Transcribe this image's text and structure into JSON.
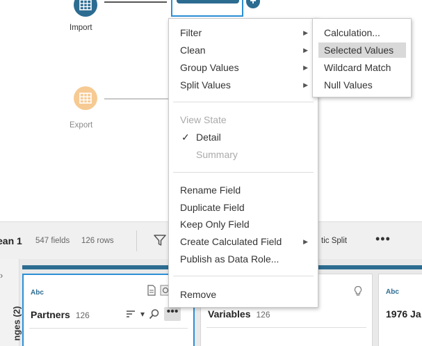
{
  "flow": {
    "import_label": "Import",
    "export_label": "Export",
    "plus_symbol": "+",
    "colors": {
      "import_node": "#2c6c91",
      "export_node": "#f6ca93",
      "selection": "#2b8fd6"
    }
  },
  "toolbar": {
    "step_name": "ean 1",
    "fields": "547 fields",
    "rows": "126 rows",
    "filter_icon": "filter-icon",
    "split_label": "tic Split",
    "more_label": "•••"
  },
  "profile": {
    "side_chevron": "›",
    "side_label": "nges (2)",
    "cards": [
      {
        "type": "Abc",
        "name": "Partners",
        "count": "126"
      },
      {
        "type": "",
        "name": "Variables",
        "count": "126"
      },
      {
        "type": "Abc",
        "name": "1976 Ja",
        "count": ""
      }
    ],
    "more_label": "•••",
    "dropdown_glyph": "▾"
  },
  "menu": {
    "filter": "Filter",
    "clean": "Clean",
    "group_values": "Group Values",
    "split_values": "Split Values",
    "view_state": "View State",
    "check_glyph": "✓",
    "detail": "Detail",
    "summary": "Summary",
    "rename_field": "Rename Field",
    "duplicate_field": "Duplicate Field",
    "keep_only_field": "Keep Only Field",
    "create_calculated_field": "Create Calculated Field",
    "publish_as_data_role": "Publish as Data Role...",
    "remove": "Remove",
    "arrow_glyph": "▶"
  },
  "submenu": {
    "calculation": "Calculation...",
    "selected_values": "Selected Values",
    "wildcard_match": "Wildcard Match",
    "null_values": "Null Values"
  }
}
